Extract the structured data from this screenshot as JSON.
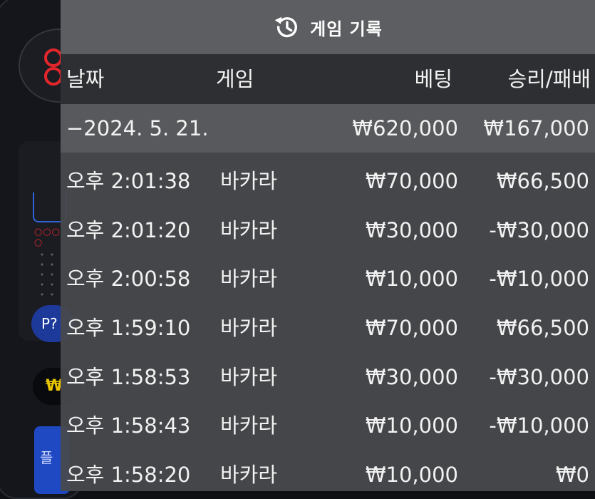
{
  "background": {
    "p_button_label": "P?",
    "pill_label": "₩",
    "side_button_label": "플"
  },
  "panel": {
    "title": "게임 기록",
    "icon": "history-icon"
  },
  "columns": {
    "date": "날짜",
    "game": "게임",
    "bet": "베팅",
    "result": "승리/패배"
  },
  "date_group": {
    "date": "−2024. 5. 21.",
    "total_bet": "₩620,000",
    "total_result": "₩167,000"
  },
  "rows": [
    {
      "time": "오후 2:01:38",
      "game": "바카라",
      "bet": "₩70,000",
      "result": "₩66,500"
    },
    {
      "time": "오후 2:01:20",
      "game": "바카라",
      "bet": "₩30,000",
      "result": "-₩30,000"
    },
    {
      "time": "오후 2:00:58",
      "game": "바카라",
      "bet": "₩10,000",
      "result": "-₩10,000"
    },
    {
      "time": "오후 1:59:10",
      "game": "바카라",
      "bet": "₩70,000",
      "result": "₩66,500"
    },
    {
      "time": "오후 1:58:53",
      "game": "바카라",
      "bet": "₩30,000",
      "result": "-₩30,000"
    },
    {
      "time": "오후 1:58:43",
      "game": "바카라",
      "bet": "₩10,000",
      "result": "-₩10,000"
    },
    {
      "time": "오후 1:58:20",
      "game": "바카라",
      "bet": "₩10,000",
      "result": "₩0"
    }
  ]
}
